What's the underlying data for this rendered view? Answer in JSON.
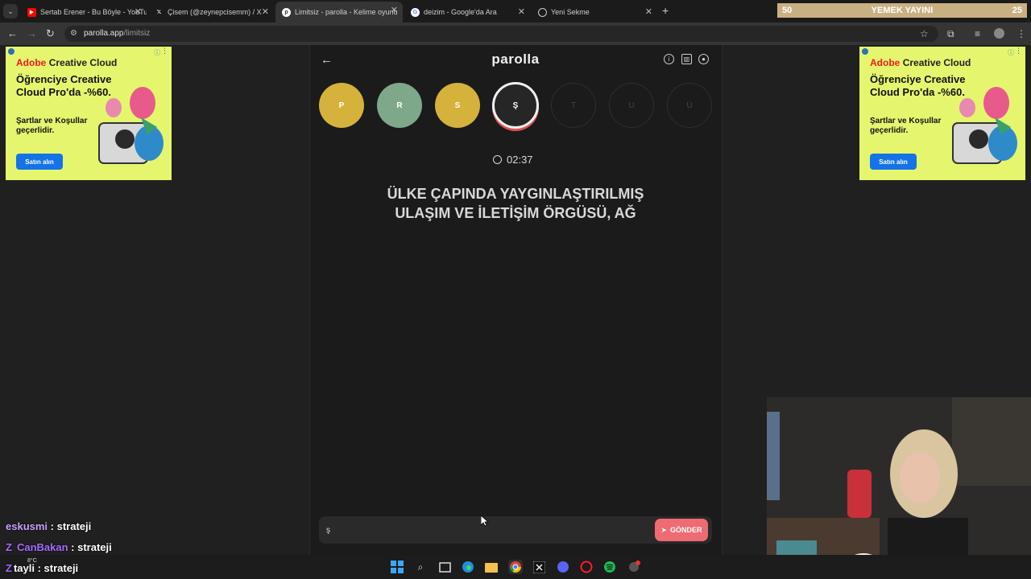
{
  "browser": {
    "tabs": [
      {
        "title": "Sertab Erener - Bu Böyle - YouTube",
        "icon": "youtube-icon",
        "color": "#ff0000"
      },
      {
        "title": "Çisem (@zeynepcisemm) / X",
        "icon": "x-icon",
        "color": "#000000"
      },
      {
        "title": "Limitsiz - parolla - Kelime oyunu",
        "icon": "parolla-icon",
        "color": "#ffffff",
        "active": true
      },
      {
        "title": "deizim - Google'da Ara",
        "icon": "google-icon",
        "color": "#4285f4"
      },
      {
        "title": "Yeni Sekme",
        "icon": "chrome-icon",
        "color": "#cccccc"
      }
    ],
    "url_host": "parolla.app",
    "url_path": "/limitsiz"
  },
  "stream_overlay": {
    "left": "50",
    "center": "YEMEK YAYINI",
    "right": "25"
  },
  "game": {
    "logo": "parolla",
    "letters": [
      {
        "letter": "P",
        "state": "correct-yellow",
        "color": "#d4b23c"
      },
      {
        "letter": "R",
        "state": "correct-green",
        "color": "#7fa88a"
      },
      {
        "letter": "S",
        "state": "correct-yellow",
        "color": "#d4b23c"
      },
      {
        "letter": "Ş",
        "state": "current"
      },
      {
        "letter": "T",
        "state": "pending"
      },
      {
        "letter": "U",
        "state": "pending"
      },
      {
        "letter": "Ü",
        "state": "pending"
      }
    ],
    "timer": "02:37",
    "question_line1": "ÜLKE ÇAPINDA YAYGINLAŞTIRILMIŞ",
    "question_line2": "ULAŞIM VE İLETİŞİM ÖRGÜSÜ, AĞ",
    "answer_value": "ş",
    "submit_label": "GÖNDER"
  },
  "ads": {
    "brand_a": "Adobe",
    "brand_b": "Creative Cloud",
    "headline": "Öğrenciye Creative Cloud Pro'da -%60.",
    "subtext": "Şartlar ve Koşullar geçerlidir.",
    "cta": "Satın alın"
  },
  "chat": [
    {
      "user": "eskusmi",
      "message": ": strateji"
    },
    {
      "user": "CanBakan",
      "message": ": strateji"
    },
    {
      "user": "tayli",
      "message": ": strateji"
    }
  ],
  "weather": "8°C"
}
